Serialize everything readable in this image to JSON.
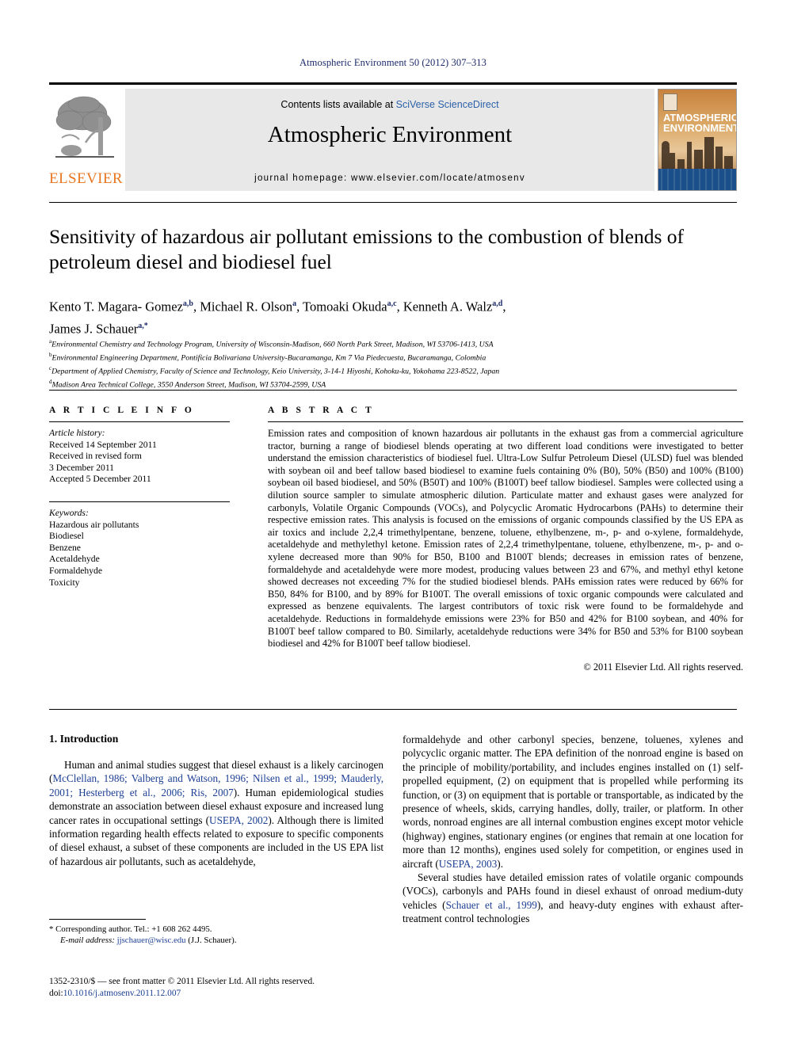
{
  "running_head": "Atmospheric Environment 50 (2012) 307–313",
  "masthead": {
    "contents_prefix": "Contents lists available at ",
    "sciencedirect": "SciVerse ScienceDirect",
    "journal_name": "Atmospheric Environment",
    "homepage": "journal homepage: www.elsevier.com/locate/atmosenv",
    "publisher": "ELSEVIER",
    "cover_title_line1": "ATMOSPHERIC",
    "cover_title_line2": "ENVIRONMENT",
    "accent_orange": "#e87722",
    "link_blue": "#2b61a8"
  },
  "article": {
    "title": "Sensitivity of hazardous air pollutant emissions to the combustion of blends of petroleum diesel and biodiesel fuel",
    "authors_line1": "Kento T. Magara- Gomez",
    "authors_sup1": "a,b",
    "authors_line2": ", Michael R. Olson",
    "authors_sup2": "a",
    "authors_line3": ", Tomoaki Okuda",
    "authors_sup3": "a,c",
    "authors_line4": ", Kenneth A. Walz",
    "authors_sup4": "a,d",
    "authors_line5": ",",
    "authors_line6": "James J. Schauer",
    "authors_sup6": "a,*",
    "affiliations": [
      {
        "mark": "a",
        "text": "Environmental Chemistry and Technology Program, University of Wisconsin-Madison, 660 North Park Street, Madison, WI 53706-1413, USA"
      },
      {
        "mark": "b",
        "text": "Environmental Engineering Department, Pontificia Bolivariana University-Bucaramanga, Km 7 Via Piedecuesta, Bucaramanga, Colombia"
      },
      {
        "mark": "c",
        "text": "Department of Applied Chemistry, Faculty of Science and Technology, Keio University, 3-14-1 Hiyoshi, Kohoku-ku, Yokohama 223-8522, Japan"
      },
      {
        "mark": "d",
        "text": "Madison Area Technical College, 3550 Anderson Street, Madison, WI 53704-2599, USA"
      }
    ]
  },
  "article_info": {
    "heading": "A R T I C L E   I N F O",
    "history_label": "Article history:",
    "history": [
      "Received 14 September 2011",
      "Received in revised form",
      "3 December 2011",
      "Accepted 5 December 2011"
    ],
    "keywords_label": "Keywords:",
    "keywords": [
      "Hazardous air pollutants",
      "Biodiesel",
      "Benzene",
      "Acetaldehyde",
      "Formaldehyde",
      "Toxicity"
    ]
  },
  "abstract": {
    "heading": "A B S T R A C T",
    "text": "Emission rates and composition of known hazardous air pollutants in the exhaust gas from a commercial agriculture tractor, burning a range of biodiesel blends operating at two different load conditions were investigated to better understand the emission characteristics of biodiesel fuel. Ultra-Low Sulfur Petroleum Diesel (ULSD) fuel was blended with soybean oil and beef tallow based biodiesel to examine fuels containing 0% (B0), 50% (B50) and 100% (B100) soybean oil based biodiesel, and 50% (B50T) and 100% (B100T) beef tallow biodiesel. Samples were collected using a dilution source sampler to simulate atmospheric dilution. Particulate matter and exhaust gases were analyzed for carbonyls, Volatile Organic Compounds (VOCs), and Polycyclic Aromatic Hydrocarbons (PAHs) to determine their respective emission rates. This analysis is focused on the emissions of organic compounds classified by the US EPA as air toxics and include 2,2,4 trimethylpentane, benzene, toluene, ethylbenzene, m-, p- and o-xylene, formaldehyde, acetaldehyde and methylethyl ketone. Emission rates of 2,2,4 trimethylpentane, toluene, ethylbenzene, m-, p- and o-xylene decreased more than 90% for B50, B100 and B100T blends; decreases in emission rates of benzene, formaldehyde and acetaldehyde were more modest, producing values between 23 and 67%, and methyl ethyl ketone showed decreases not exceeding 7% for the studied biodiesel blends. PAHs emission rates were reduced by 66% for B50, 84% for B100, and by 89% for B100T. The overall emissions of toxic organic compounds were calculated and expressed as benzene equivalents. The largest contributors of toxic risk were found to be formaldehyde and acetaldehyde. Reductions in formaldehyde emissions were 23% for B50 and 42% for B100 soybean, and 40% for B100T beef tallow compared to B0. Similarly, acetaldehyde reductions were 34% for B50 and 53% for B100 soybean biodiesel and 42% for B100T beef tallow biodiesel.",
    "copyright": "© 2011 Elsevier Ltd. All rights reserved."
  },
  "introduction": {
    "heading": "1.  Introduction",
    "left_paragraph_pre": "Human and animal studies suggest that diesel exhaust is a likely carcinogen (",
    "left_refs_1": "McClellan, 1986; Valberg and Watson, 1996; Nilsen et al., 1999; Mauderly, 2001; Hesterberg et al., 2006; Ris, 2007",
    "left_paragraph_mid": "). Human epidemiological studies demonstrate an association between diesel exhaust exposure and increased lung cancer rates in occupational settings (",
    "left_refs_2": "USEPA, 2002",
    "left_paragraph_post": "). Although there is limited information regarding health effects related to exposure to specific components of diesel exhaust, a subset of these components are included in the US EPA list of hazardous air pollutants, such as acetaldehyde,",
    "right_paragraph_a_pre": "formaldehyde and other carbonyl species, benzene, toluenes, xylenes and polycyclic organic matter. The EPA definition of the nonroad engine is based on the principle of mobility/portability, and includes engines installed on (1) self-propelled equipment, (2) on equipment that is propelled while performing its function, or (3) on equipment that is portable or transportable, as indicated by the presence of wheels, skids, carrying handles, dolly, trailer, or platform. In other words, nonroad engines are all internal combustion engines except motor vehicle (highway) engines, stationary engines (or engines that remain at one location for more than 12 months), engines used solely for competition, or engines used in aircraft (",
    "right_refs_1": "USEPA, 2003",
    "right_paragraph_a_post": ").",
    "right_paragraph_b_pre": "Several studies have detailed emission rates of volatile organic compounds (VOCs), carbonyls and PAHs found in diesel exhaust of onroad medium-duty vehicles (",
    "right_refs_2": "Schauer et al., 1999",
    "right_paragraph_b_post": "), and heavy-duty engines with exhaust after-treatment control technologies"
  },
  "footnote": {
    "corresponding": "* Corresponding author. Tel.: +1 608 262 4495.",
    "email_label": "E-mail address:",
    "email": "jjschauer@wisc.edu",
    "email_suffix": "(J.J. Schauer).",
    "issn_line": "1352-2310/$ — see front matter © 2011 Elsevier Ltd. All rights reserved.",
    "doi_label": "doi:",
    "doi": "10.1016/j.atmosenv.2011.12.007"
  }
}
